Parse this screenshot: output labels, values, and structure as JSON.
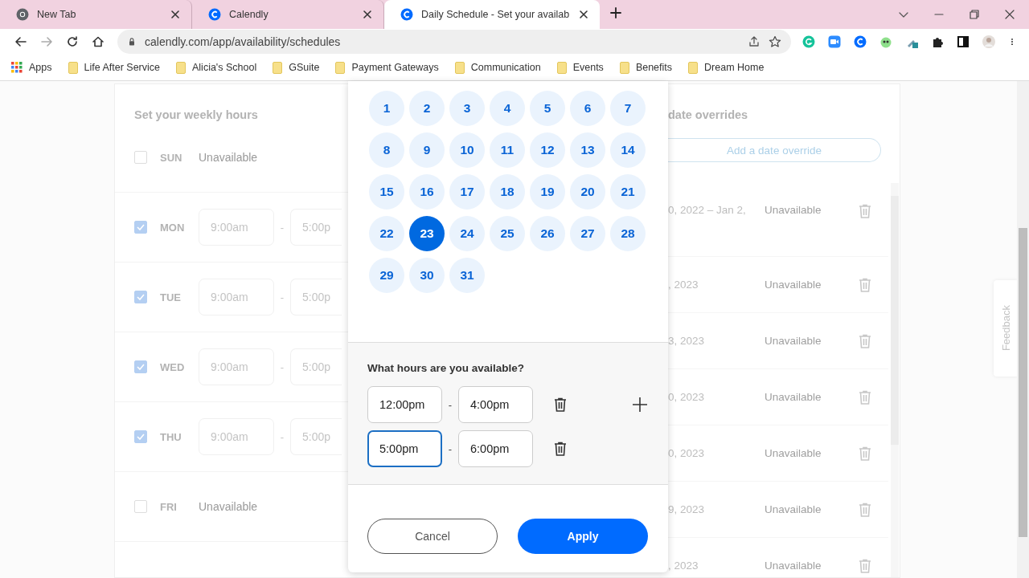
{
  "browser": {
    "tabs": [
      {
        "title": "New Tab",
        "kind": "chrome",
        "selected": false
      },
      {
        "title": "Calendly",
        "kind": "calendly",
        "selected": false
      },
      {
        "title": "Daily Schedule - Set your availab",
        "kind": "calendly",
        "selected": true
      }
    ],
    "address": "calendly.com/app/availability/schedules",
    "bookmarks": [
      {
        "label": "Apps",
        "kind": "apps"
      },
      {
        "label": "Life After Service",
        "kind": "folder"
      },
      {
        "label": "Alicia's School",
        "kind": "folder"
      },
      {
        "label": "GSuite",
        "kind": "folder"
      },
      {
        "label": "Payment Gateways",
        "kind": "folder"
      },
      {
        "label": "Communication",
        "kind": "folder"
      },
      {
        "label": "Events",
        "kind": "folder"
      },
      {
        "label": "Benefits",
        "kind": "folder"
      },
      {
        "label": "Dream Home",
        "kind": "folder"
      }
    ]
  },
  "weekly": {
    "title": "Set your weekly hours",
    "days": [
      {
        "day": "SUN",
        "checked": false,
        "status": "Unavailable"
      },
      {
        "day": "MON",
        "checked": true,
        "start": "9:00am",
        "separator": "-",
        "end": "5:00p"
      },
      {
        "day": "TUE",
        "checked": true,
        "start": "9:00am",
        "separator": "-",
        "end": "5:00p"
      },
      {
        "day": "WED",
        "checked": true,
        "start": "9:00am",
        "separator": "-",
        "end": "5:00p"
      },
      {
        "day": "THU",
        "checked": true,
        "start": "9:00am",
        "separator": "-",
        "end": "5:00p"
      },
      {
        "day": "FRI",
        "checked": false,
        "status": "Unavailable"
      }
    ]
  },
  "overrides": {
    "title": "date overrides",
    "add_button": "Add a date override",
    "rows": [
      {
        "dates": "0, 2022 – Jan 2,",
        "status": "Unavailable"
      },
      {
        "dates": ", 2023",
        "status": "Unavailable"
      },
      {
        "dates": "3, 2023",
        "status": "Unavailable"
      },
      {
        "dates": "0, 2023",
        "status": "Unavailable"
      },
      {
        "dates": "0, 2023",
        "status": "Unavailable"
      },
      {
        "dates": "9, 2023",
        "status": "Unavailable"
      },
      {
        "dates": ", 2023",
        "status": "Unavailable"
      }
    ]
  },
  "feedback": "Feedback",
  "modal": {
    "days": [
      {
        "label": "1",
        "selected": false
      },
      {
        "label": "2",
        "selected": false
      },
      {
        "label": "3",
        "selected": false
      },
      {
        "label": "4",
        "selected": false
      },
      {
        "label": "5",
        "selected": false
      },
      {
        "label": "6",
        "selected": false
      },
      {
        "label": "7",
        "selected": false
      },
      {
        "label": "8",
        "selected": false
      },
      {
        "label": "9",
        "selected": false
      },
      {
        "label": "10",
        "selected": false
      },
      {
        "label": "11",
        "selected": false
      },
      {
        "label": "12",
        "selected": false
      },
      {
        "label": "13",
        "selected": false
      },
      {
        "label": "14",
        "selected": false
      },
      {
        "label": "15",
        "selected": false
      },
      {
        "label": "16",
        "selected": false
      },
      {
        "label": "17",
        "selected": false
      },
      {
        "label": "18",
        "selected": false
      },
      {
        "label": "19",
        "selected": false
      },
      {
        "label": "20",
        "selected": false
      },
      {
        "label": "21",
        "selected": false
      },
      {
        "label": "22",
        "selected": false
      },
      {
        "label": "23",
        "selected": true
      },
      {
        "label": "24",
        "selected": false
      },
      {
        "label": "25",
        "selected": false
      },
      {
        "label": "26",
        "selected": false
      },
      {
        "label": "27",
        "selected": false
      },
      {
        "label": "28",
        "selected": false
      },
      {
        "label": "29",
        "selected": false
      },
      {
        "label": "30",
        "selected": false
      },
      {
        "label": "31",
        "selected": false
      }
    ],
    "hours_title": "What hours are you available?",
    "slots": [
      {
        "start": "12:00pm",
        "separator": "-",
        "end": "4:00pm",
        "focused": false
      },
      {
        "start": "5:00pm",
        "separator": "-",
        "end": "6:00pm",
        "focused": true
      }
    ],
    "cancel": "Cancel",
    "apply": "Apply"
  }
}
